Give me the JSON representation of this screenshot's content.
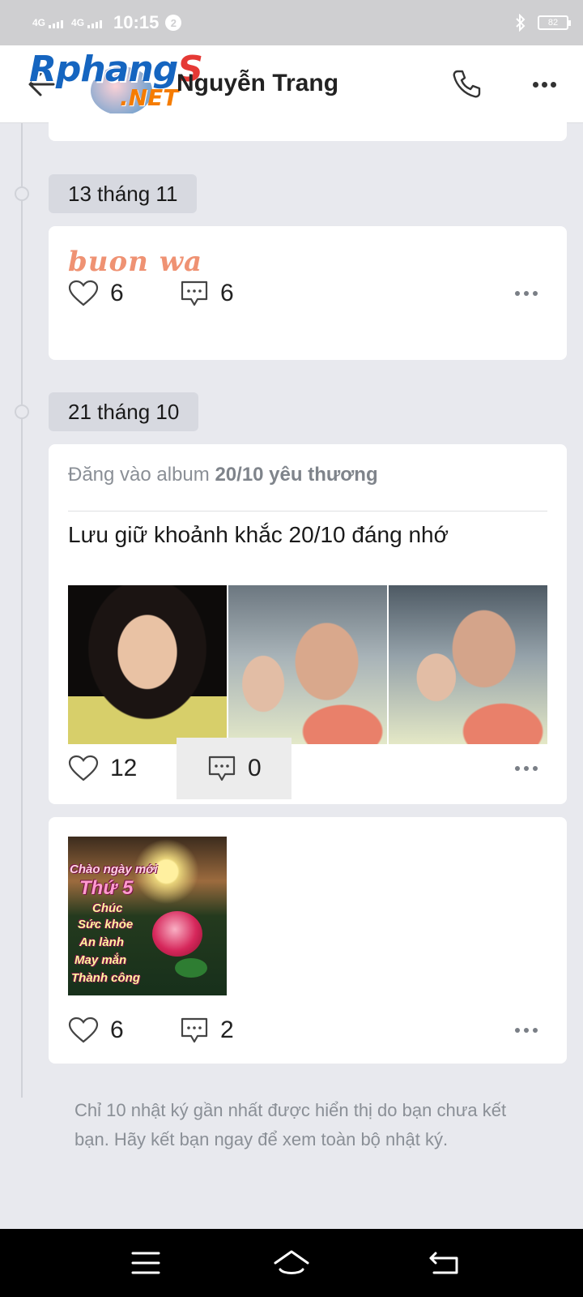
{
  "status_bar": {
    "net1": "4G",
    "net2": "4G",
    "time": "10:15",
    "notif_count": "2",
    "battery": "82"
  },
  "header": {
    "logo_main": "Rphang",
    "logo_accent": "S",
    "logo_sub": ".NET",
    "title": "Nguyễn Trang"
  },
  "timeline": [
    {
      "date": "13 tháng 11",
      "posts": [
        {
          "text": "buon wa",
          "likes": "6",
          "comments": "6"
        }
      ]
    },
    {
      "date": "21 tháng 10",
      "posts": [
        {
          "album_prefix": "Đăng vào album",
          "album_name": "20/10 yêu thương",
          "caption": "Lưu giữ khoảnh khắc 20/10 đáng nhớ",
          "photos": [
            "girl-portrait",
            "mother-and-daughter-selfie",
            "mother-and-daughter-selfie-2"
          ],
          "likes": "12",
          "comments": "0"
        },
        {
          "image_text": [
            "Chào ngày mới",
            "Thứ 5",
            "Chúc",
            "Sức khỏe",
            "An lành",
            "May mắn",
            "Thành công"
          ],
          "likes": "6",
          "comments": "2"
        }
      ]
    }
  ],
  "footer_note": "Chỉ 10 nhật ký gần nhất được hiển thị do bạn chưa kết bạn. Hãy kết bạn ngay để xem toàn bộ nhật ký.",
  "icons": [
    "back-arrow-icon",
    "phone-icon",
    "more-icon",
    "heart-icon",
    "comment-icon",
    "menu-icon",
    "home-icon",
    "back-icon"
  ]
}
